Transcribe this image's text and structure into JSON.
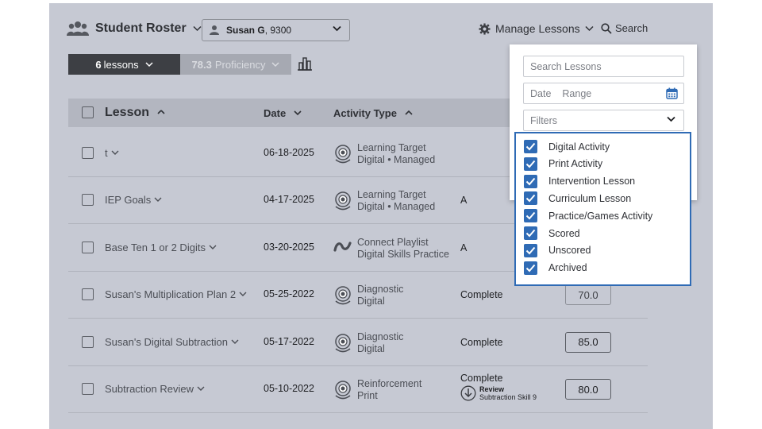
{
  "header": {
    "roster_title": "Student Roster",
    "student_name": "Susan G",
    "student_id": ", 9300",
    "manage_label": "Manage Lessons",
    "search_label": "Search"
  },
  "summary": {
    "lessons_count": "6",
    "lessons_label": "lessons",
    "proficiency_value": "78.3",
    "proficiency_label": "Proficiency"
  },
  "table": {
    "headers": {
      "lesson": "Lesson",
      "date": "Date",
      "activity": "Activity Type"
    },
    "rows": [
      {
        "lesson": "t",
        "date": "06-18-2025",
        "act1": "Learning Target",
        "act2": "Digital • Managed",
        "icon": "target-icon",
        "status": "",
        "score": ""
      },
      {
        "lesson": "IEP Goals",
        "date": "04-17-2025",
        "act1": "Learning Target",
        "act2": "Digital • Managed",
        "icon": "target-icon",
        "status": "A",
        "score": ""
      },
      {
        "lesson": "Base Ten 1 or 2 Digits",
        "date": "03-20-2025",
        "act1": "Connect Playlist",
        "act2": "Digital Skills Practice",
        "icon": "playlist-icon",
        "status": "A",
        "score": ""
      },
      {
        "lesson": "Susan's Multiplication Plan 2",
        "date": "05-25-2022",
        "act1": "Diagnostic",
        "act2": "Digital",
        "icon": "target-icon",
        "status": "Complete",
        "score": "70.0"
      },
      {
        "lesson": "Susan's Digital Subtraction",
        "date": "05-17-2022",
        "act1": "Diagnostic",
        "act2": "Digital",
        "icon": "target-icon",
        "status": "Complete",
        "score": "85.0"
      },
      {
        "lesson": "Subtraction Review",
        "date": "05-10-2022",
        "act1": "Reinforcement",
        "act2": "Print",
        "icon": "target-icon",
        "status": "Complete",
        "sub_title": "Review",
        "sub_detail": "Subtraction Skill 9",
        "score": "80.0"
      }
    ]
  },
  "dropdown": {
    "search_placeholder": "Search Lessons",
    "date_label": "Date",
    "range_label": "Range",
    "filters_label": "Filters",
    "filter_options": [
      {
        "label": "Digital Activity",
        "checked": true
      },
      {
        "label": "Print Activity",
        "checked": true
      },
      {
        "label": "Intervention Lesson",
        "checked": true
      },
      {
        "label": "Curriculum Lesson",
        "checked": true
      },
      {
        "label": "Practice/Games Activity",
        "checked": true
      },
      {
        "label": "Scored",
        "checked": true
      },
      {
        "label": "Unscored",
        "checked": true
      },
      {
        "label": "Archived",
        "checked": true
      }
    ]
  },
  "colors": {
    "accent": "#2f6bb5",
    "overlay": "#c6c9d3",
    "dark_segment": "#3d3f44"
  }
}
